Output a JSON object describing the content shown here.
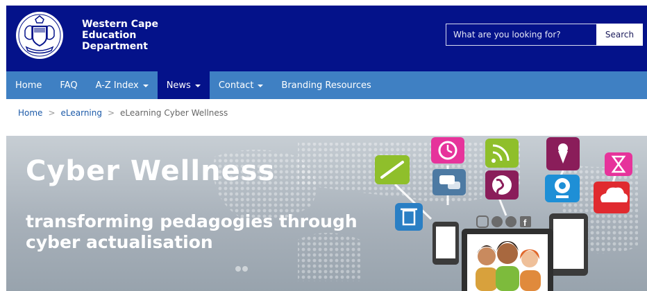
{
  "header": {
    "org_name_line1": "Western Cape",
    "org_name_line2": "Education",
    "org_name_line3": "Department",
    "logo_icon": "coat-of-arms-icon",
    "brand_color": "#04128a"
  },
  "search": {
    "placeholder": "What are you looking for?",
    "button_label": "Search"
  },
  "nav": {
    "bar_color": "#3f80c3",
    "items": [
      {
        "label": "Home"
      },
      {
        "label": "FAQ"
      },
      {
        "label": "A-Z Index"
      },
      {
        "label": "News"
      },
      {
        "label": "Contact"
      },
      {
        "label": "Branding Resources"
      }
    ]
  },
  "breadcrumb": {
    "items": [
      "Home",
      "eLearning",
      "eLearning Cyber Wellness"
    ],
    "separator": ">"
  },
  "banner": {
    "title": "Cyber Wellness",
    "subtitle_line1": "transforming pedagogies through",
    "subtitle_line2": "cyber actualisation",
    "icons": [
      "pencil-icon",
      "trash-icon",
      "chat-icon",
      "clock-icon",
      "rss-icon",
      "globe-icon",
      "ice-cream-icon",
      "webcam-icon",
      "hourglass-icon",
      "cloud-icon",
      "instagram-icon",
      "twitter-icon",
      "wordpress-icon",
      "facebook-icon",
      "tablet-icon",
      "phone-icon",
      "laptop-icon"
    ]
  }
}
